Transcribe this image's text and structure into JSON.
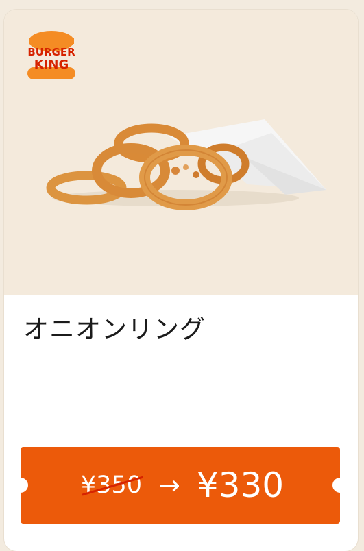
{
  "brand": {
    "logo_line1": "BURGER",
    "logo_line2": "KING"
  },
  "product": {
    "name": "オニオンリング",
    "image_alt": "onion-rings"
  },
  "coupon": {
    "old_price": "¥350",
    "arrow": "→",
    "new_price": "¥330"
  },
  "colors": {
    "accent": "#ec5a0a",
    "hero_bg": "#f4eadc",
    "page_bg": "#f3ebdf",
    "logo_bun": "#f48c24",
    "logo_text": "#d62300"
  }
}
